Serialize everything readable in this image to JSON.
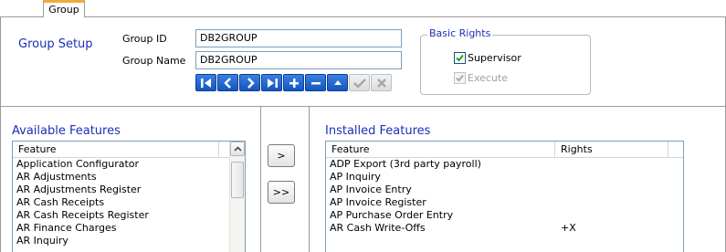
{
  "tab": {
    "label": "Group"
  },
  "group_setup": {
    "title": "Group Setup",
    "group_id_label": "Group ID",
    "group_id_value": "DB2GROUP",
    "group_name_label": "Group Name",
    "group_name_value": "DB2GROUP"
  },
  "navigation": {
    "buttons": [
      "first-icon",
      "previous-icon",
      "next-icon",
      "last-icon",
      "add-icon",
      "delete-icon",
      "up-icon",
      "confirm-icon",
      "cancel-icon"
    ]
  },
  "basic_rights": {
    "title": "Basic Rights",
    "supervisor_label": "Supervisor",
    "supervisor_checked": true,
    "execute_label": "Execute",
    "execute_checked": true,
    "execute_disabled": true
  },
  "available": {
    "title": "Available Features",
    "column": "Feature",
    "items": [
      "Application Configurator",
      "AR Adjustments",
      "AR Adjustments Register",
      "AR Cash Receipts",
      "AR Cash Receipts Register",
      "AR Finance Charges",
      "AR Inquiry"
    ]
  },
  "move_buttons": {
    "single": ">",
    "all": ">>"
  },
  "installed": {
    "title": "Installed Features",
    "columns": [
      "Feature",
      "Rights"
    ],
    "items": [
      {
        "feature": "ADP Export (3rd party payroll)",
        "rights": ""
      },
      {
        "feature": "AP Inquiry",
        "rights": ""
      },
      {
        "feature": "AP Invoice Entry",
        "rights": ""
      },
      {
        "feature": "AP Invoice Register",
        "rights": ""
      },
      {
        "feature": "AP Purchase Order Entry",
        "rights": ""
      },
      {
        "feature": "AR Cash Write-Offs",
        "rights": "+X"
      }
    ]
  },
  "colors": {
    "title_blue": "#1a2fb8",
    "tab_accent": "#f2a93b",
    "nav_blue": "#1356c2"
  }
}
